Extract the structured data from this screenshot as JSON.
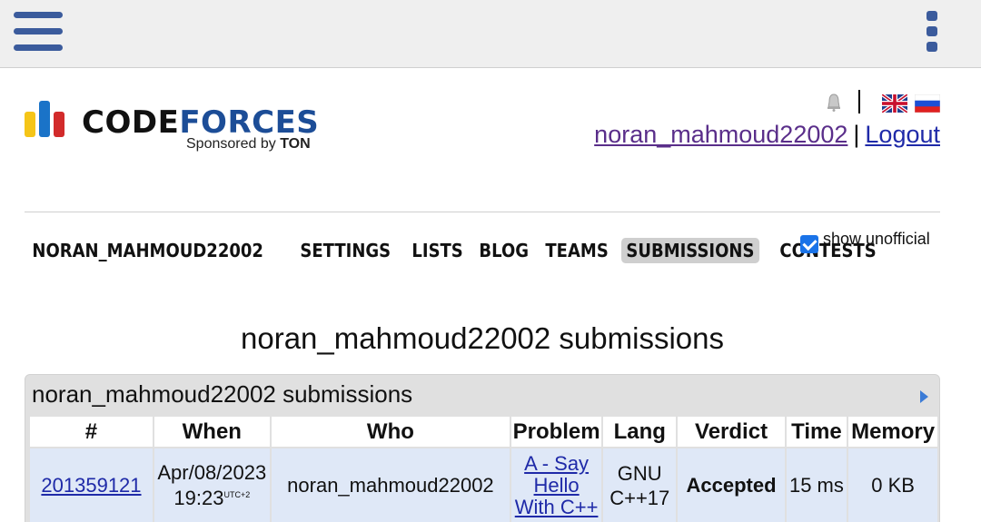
{
  "browser": {
    "menu_icon": "hamburger-menu-icon",
    "more_icon": "kebab-more-icon"
  },
  "logo": {
    "word_code": "CODE",
    "word_forces": "FORCES",
    "sponsor_prefix": "Sponsored by ",
    "sponsor_name": "TON",
    "colors": {
      "yellow": "#f5c518",
      "blue": "#1a73c8",
      "red": "#d22b2b",
      "forces": "#1c4d97"
    }
  },
  "header": {
    "username": "noran_mahmoud22002",
    "separator": "|",
    "logout": "Logout",
    "icons": [
      "bell-icon",
      "flag-en-icon",
      "flag-ru-icon"
    ]
  },
  "nav": {
    "items": [
      {
        "label": "NORAN_MAHMOUD22002",
        "active": false
      },
      {
        "label": "SETTINGS",
        "active": false
      },
      {
        "label": "LISTS",
        "active": false
      },
      {
        "label": "BLOG",
        "active": false
      },
      {
        "label": "TEAMS",
        "active": false
      },
      {
        "label": "SUBMISSIONS",
        "active": true
      },
      {
        "label": "CONTESTS",
        "active": false
      }
    ]
  },
  "filter": {
    "show_unofficial_label": "show unofficial",
    "show_unofficial_checked": true
  },
  "page_title": "noran_mahmoud22002 submissions",
  "panel": {
    "title": "noran_mahmoud22002 submissions",
    "columns": [
      "#",
      "When",
      "Who",
      "Problem",
      "Lang",
      "Verdict",
      "Time",
      "Memory"
    ],
    "rows": [
      {
        "id": "201359121",
        "when_date": "Apr/08/2023",
        "when_time": "19:23",
        "when_tz": "UTC+2",
        "who": "noran_mahmoud22002",
        "problem_line1": "A - Say",
        "problem_line2": "Hello",
        "problem_line3": "With C++",
        "lang_line1": "GNU",
        "lang_line2": "C++17",
        "verdict": "Accepted",
        "time": "15 ms",
        "memory": "0 KB"
      }
    ]
  },
  "colors": {
    "accent": "#3b5b9c",
    "link": "#1f2aa8",
    "visited_link": "#5a2e8a",
    "accepted": "#0a9a0a",
    "row_bg": "#dfe8f7"
  }
}
